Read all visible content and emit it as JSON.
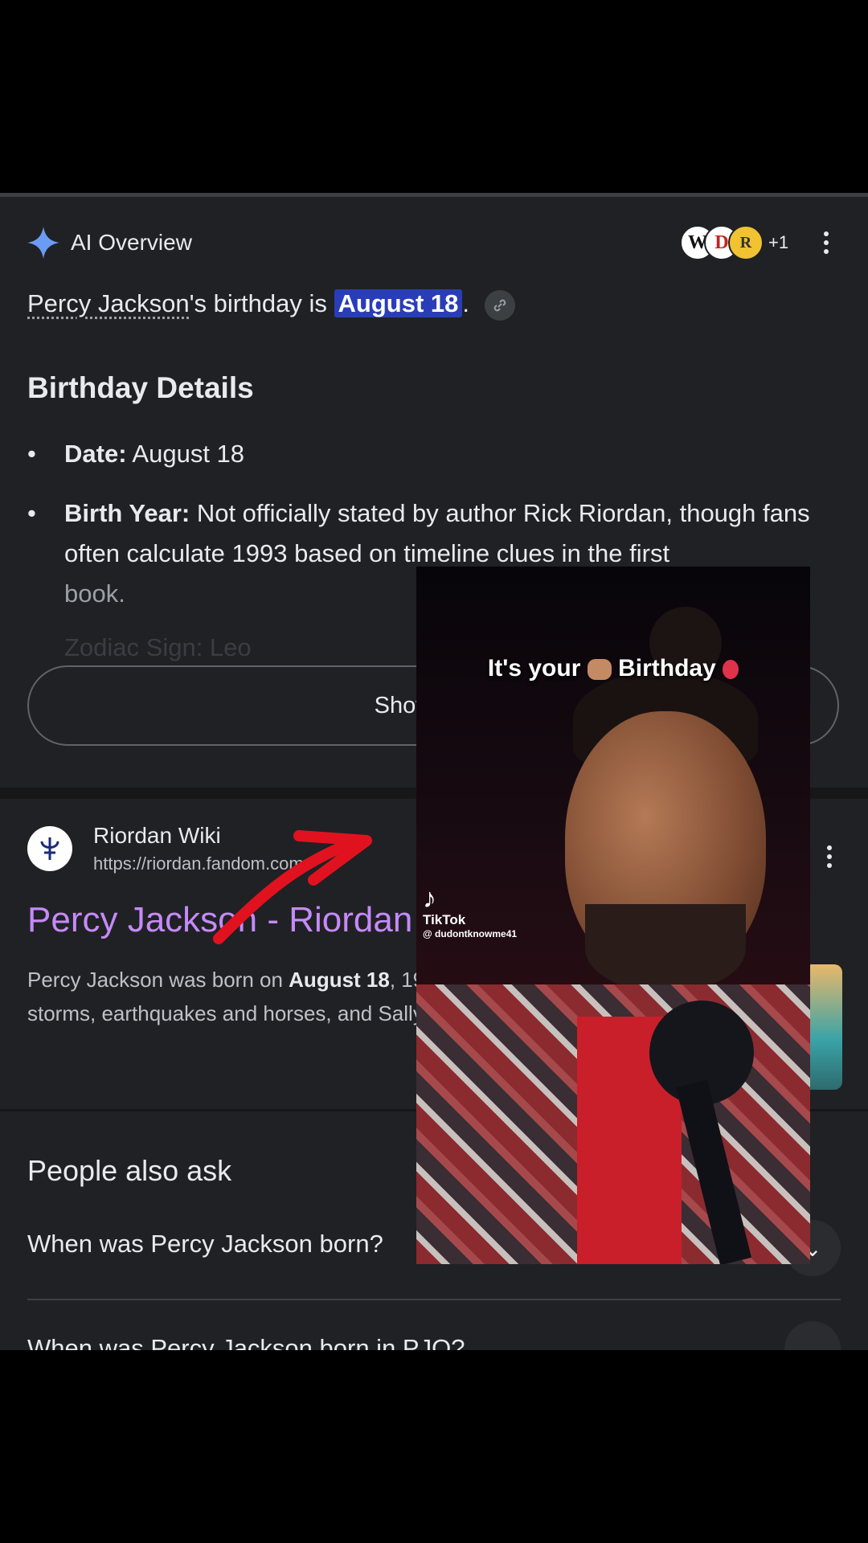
{
  "ai_overview": {
    "label": "AI Overview",
    "sources": [
      "W",
      "D",
      "R"
    ],
    "more_sources": "+1"
  },
  "answer": {
    "name": "Percy Jackson",
    "mid_text": "'s birthday is ",
    "highlight": "August 18",
    "end": "."
  },
  "details": {
    "title": "Birthday Details",
    "items": [
      {
        "label": "Date:",
        "text": " August 18"
      },
      {
        "label": "Birth Year:",
        "text": " Not officially stated by author Rick Riordan, though fans often calculate 1993 based on timeline clues in the first",
        "faded": "book."
      }
    ],
    "ghost": "Zodiac Sign: Leo",
    "show_more": "Show more"
  },
  "result": {
    "site_name": "Riordan Wiki",
    "url": "https://riordan.fandom.com",
    "title": "Percy Jackson - Riordan Wiki",
    "snippet_start": "Percy Jackson was born on ",
    "snippet_bold": "August 18",
    "snippet_rest": ", 1993, to Poseidon, the Greek god of the seas, storms, earthquakes and horses, and Sally Jackson, a mortal ..."
  },
  "people_also_ask": {
    "title": "People also ask",
    "questions": [
      "When was Percy Jackson born?",
      "When was Percy Jackson born in PJO?"
    ]
  },
  "overlay_video": {
    "caption_left": "It's your",
    "caption_right": "Birthday",
    "brand": "TikTok",
    "username": "@ dudontknowme41"
  },
  "colors": {
    "background": "#202124",
    "highlight": "#2a3db8",
    "link_title": "#c58af9",
    "arrow": "#e0121f"
  }
}
